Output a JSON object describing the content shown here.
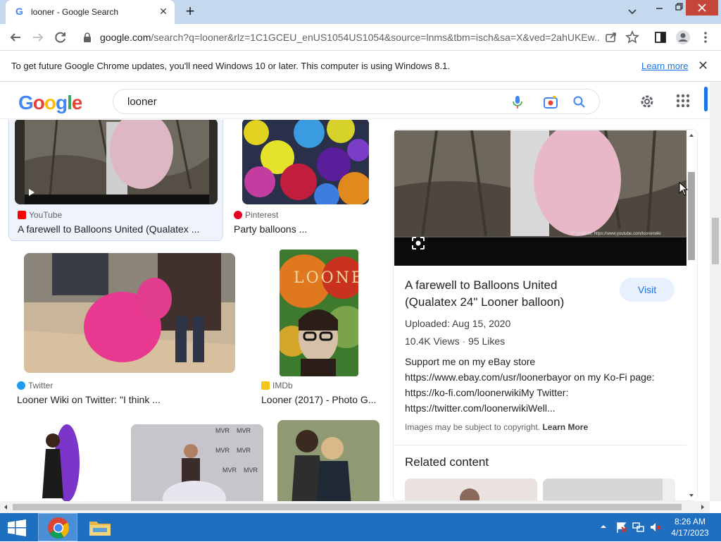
{
  "browser": {
    "tab_title": "looner - Google Search",
    "new_tab_label": "+",
    "url_host": "google.com",
    "url_rest": "/search?q=looner&rlz=1C1GCEU_enUS1054US1054&source=lnms&tbm=isch&sa=X&ved=2ahUKEw..."
  },
  "infobar": {
    "message": "To get future Google Chrome updates, you'll need Windows 10 or later. This computer is using Windows 8.1.",
    "learn_more": "Learn more"
  },
  "google": {
    "logo": "Google",
    "query": "looner"
  },
  "results": [
    {
      "source": "YouTube",
      "title": "A farewell to Balloons United (Qualatex ...",
      "fav_color": "#ff0000"
    },
    {
      "source": "Pinterest",
      "title": "Party balloons ...",
      "fav_color": "#e60023"
    },
    {
      "source": "Twitter",
      "title": "Looner Wiki on Twitter: \"I think ...",
      "fav_color": "#1d9bf0"
    },
    {
      "source": "IMDb",
      "title": "Looner (2017) - Photo G...",
      "fav_color": "#f5c518"
    }
  ],
  "poster_text": "LOONER.",
  "panel": {
    "title": "A farewell to Balloons United (Qualatex 24\" Looner balloon)",
    "visit": "Visit",
    "uploaded": "Uploaded: Aug 15, 2020",
    "views": "10.4K Views",
    "dot": "·",
    "likes": "95 Likes",
    "description_lines": [
      "Support me on my eBay store",
      "https://www.ebay.com/usr/loonerbayor on my Ko-Fi page:",
      "https://ko-fi.com/loonerwikiMy Twitter:",
      "https://twitter.com/loonerwikiWell..."
    ],
    "copyright": "Images may be subject to copyright.",
    "learn_more": "Learn More",
    "related": "Related content",
    "watermark": "YT channel: https://www.youtube.com/loonerwiki"
  },
  "taskbar": {
    "time": "8:26 AM",
    "date": "4/17/2023"
  }
}
